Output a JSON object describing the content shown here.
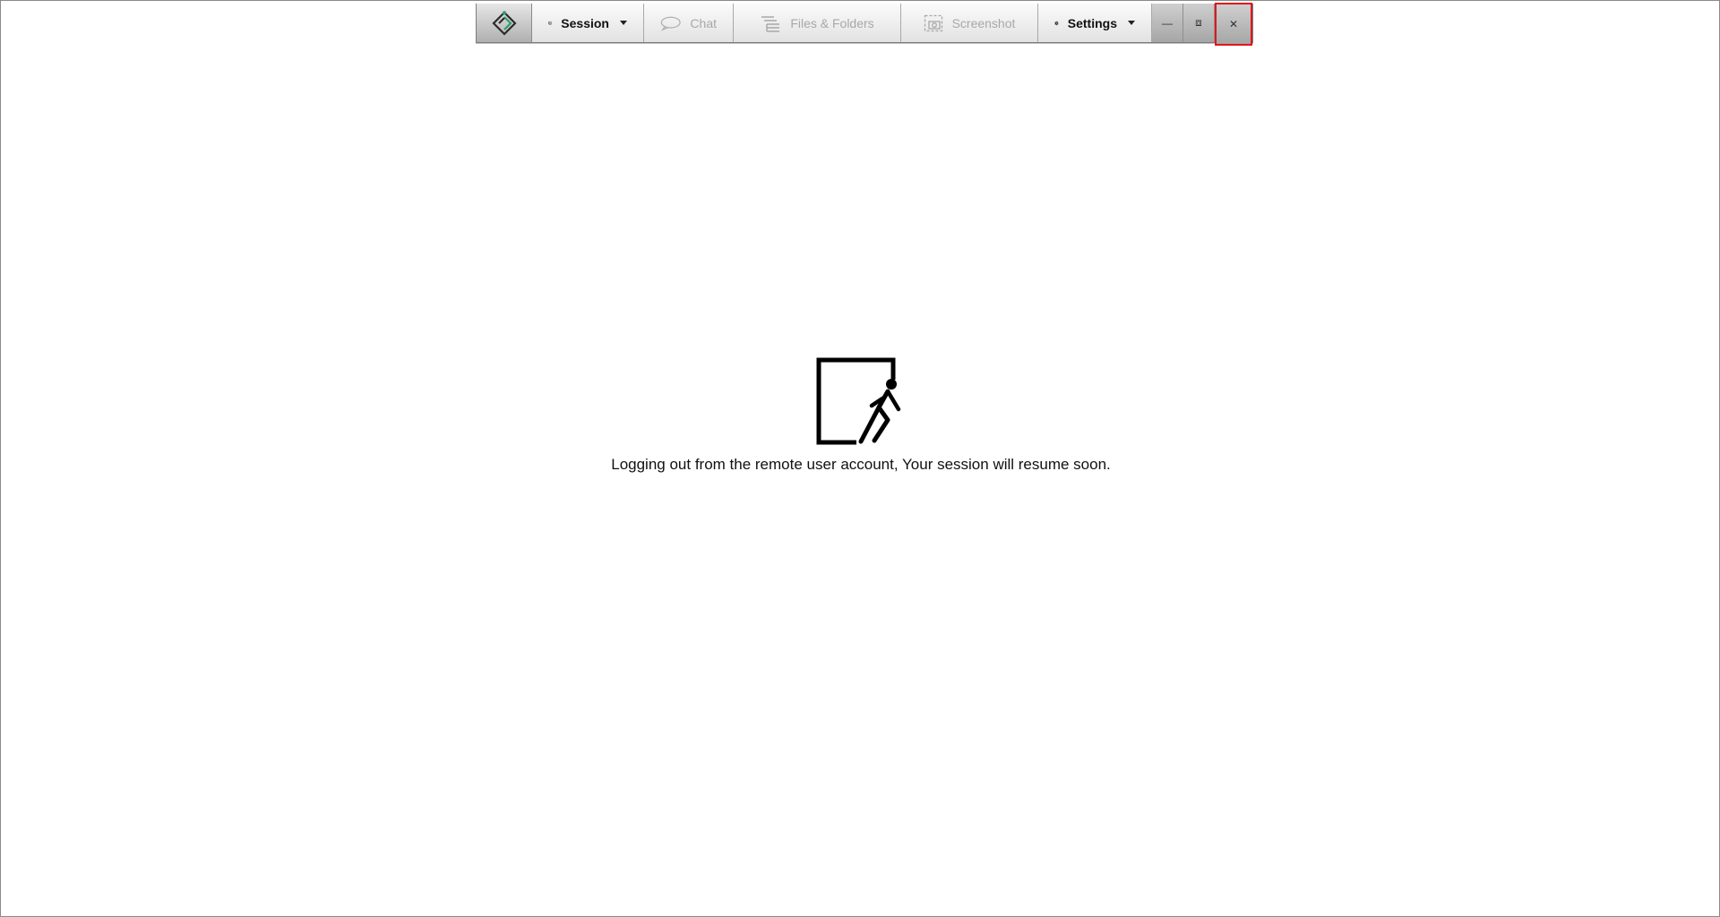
{
  "toolbar": {
    "logo_icon": "remote-support-logo-icon",
    "session_label": "Session",
    "chat_label": "Chat",
    "files_label": "Files & Folders",
    "screenshot_label": "Screenshot",
    "settings_label": "Settings",
    "minimize_glyph": "—",
    "restore_glyph": "⧈",
    "close_glyph": "✕"
  },
  "main": {
    "status_icon": "logout-door-icon",
    "message": "Logging out from the remote user account, Your session will resume soon."
  },
  "colors": {
    "accent_green": "#2e9e6e",
    "close_highlight": "#e0161c"
  }
}
